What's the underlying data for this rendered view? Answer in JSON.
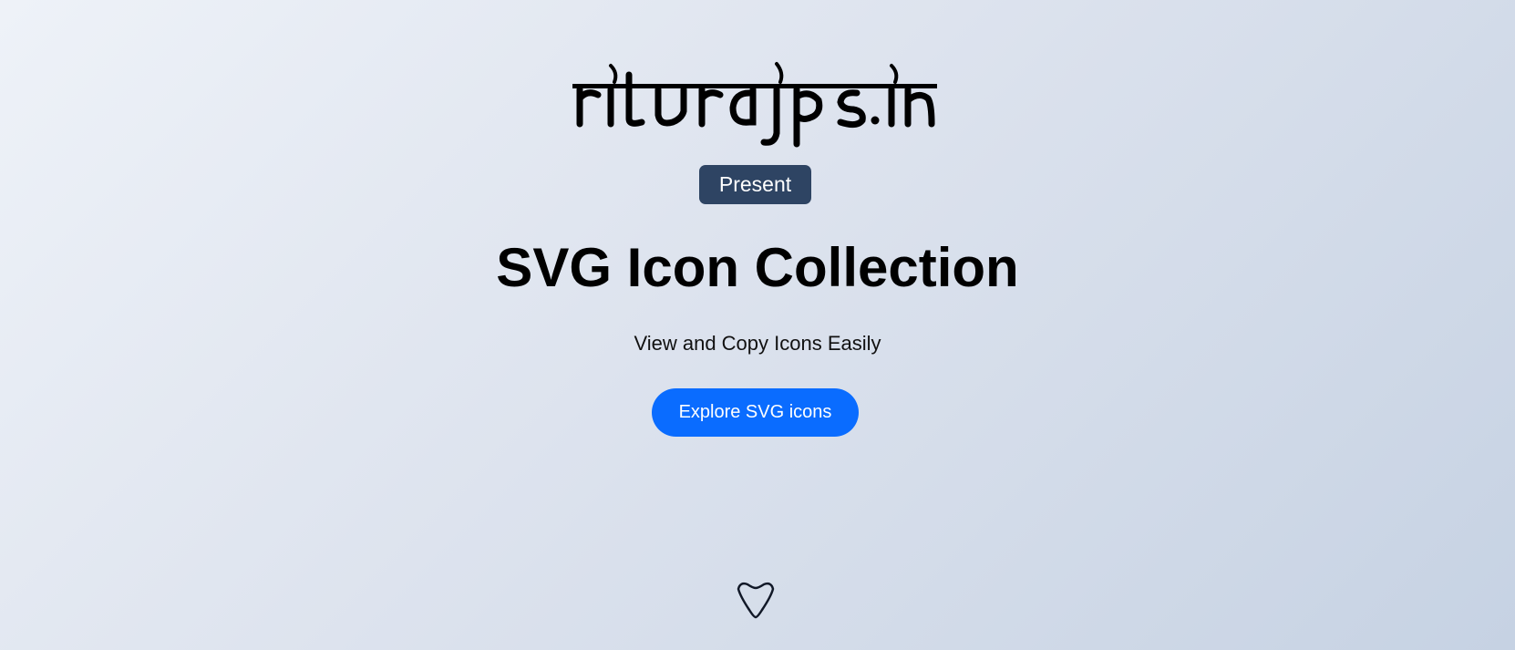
{
  "brand": {
    "logo_text": "riturajps.in"
  },
  "badge": {
    "label": "Present"
  },
  "hero": {
    "title": "SVG Icon Collection",
    "subtitle": "View and Copy Icons Easily",
    "cta_label": "Explore SVG icons"
  },
  "icons": {
    "scroll_down": "chevron-down-icon"
  },
  "colors": {
    "badge_bg": "#2e4463",
    "cta_bg": "#0a6cff",
    "text": "#000000"
  }
}
